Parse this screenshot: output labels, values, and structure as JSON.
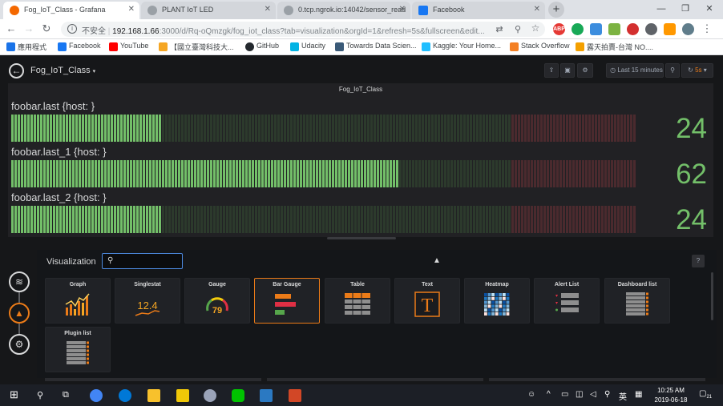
{
  "browser": {
    "tabs": [
      {
        "title": "Fog_IoT_Class - Grafana",
        "active": true,
        "icon": "grafana-icon"
      },
      {
        "title": "PLANT IoT LED",
        "active": false,
        "icon": "globe-icon"
      },
      {
        "title": "0.tcp.ngrok.io:14042/sensor_read",
        "active": false,
        "icon": "globe-icon"
      },
      {
        "title": "Facebook",
        "active": false,
        "icon": "facebook-icon"
      }
    ],
    "address": {
      "insecure_label": "不安全",
      "host": "192.168.1.66",
      "path": ":3000/d/Rq-oQmzgk/fog_iot_class?tab=visualization&orgId=1&refresh=5s&fullscreen&edit..."
    },
    "bookmarks": [
      "應用程式",
      "Facebook",
      "YouTube",
      "【國立臺灣科技大...",
      "GitHub",
      "Udacity",
      "Towards Data Scien...",
      "Kaggle: Your Home...",
      "Stack Overflow",
      "露天拍賣-台灣 NO...."
    ],
    "colors": {
      "chrome_bg": "#dee1e6",
      "grafana_bg": "#161719",
      "accent": "#eb7b18"
    }
  },
  "grafana": {
    "dashboard_title": "Fog_IoT_Class",
    "time_range": "Last 15 minutes",
    "refresh": "5s",
    "panel_title": "Fog_IoT_Class",
    "bar_gauges": [
      {
        "label": "foobar.last {host: }",
        "value": "24",
        "level": 0.24
      },
      {
        "label": "foobar.last_1 {host: }",
        "value": "62",
        "level": 0.62
      },
      {
        "label": "foobar.last_2 {host: }",
        "value": "24",
        "level": 0.24
      }
    ],
    "visualization": {
      "title": "Visualization",
      "search_placeholder": "",
      "help": "?",
      "types": [
        {
          "name": "Graph",
          "icon": "graph-icon",
          "selected": false
        },
        {
          "name": "Singlestat",
          "icon": "singlestat-icon",
          "selected": false,
          "sample": "12.4"
        },
        {
          "name": "Gauge",
          "icon": "gauge-icon",
          "selected": false,
          "sample": "79"
        },
        {
          "name": "Bar Gauge",
          "icon": "bar-gauge-icon",
          "selected": true
        },
        {
          "name": "Table",
          "icon": "table-icon",
          "selected": false
        },
        {
          "name": "Text",
          "icon": "text-icon",
          "selected": false,
          "sample": "T"
        },
        {
          "name": "Heatmap",
          "icon": "heatmap-icon",
          "selected": false
        },
        {
          "name": "Alert List",
          "icon": "alert-list-icon",
          "selected": false
        },
        {
          "name": "Dashboard list",
          "icon": "dashboard-list-icon",
          "selected": false
        },
        {
          "name": "Plugin list",
          "icon": "plugin-list-icon",
          "selected": false
        }
      ]
    }
  },
  "taskbar": {
    "time": "10:25 AM",
    "date": "2019-06-18",
    "ime": "英",
    "notifications": "21"
  }
}
